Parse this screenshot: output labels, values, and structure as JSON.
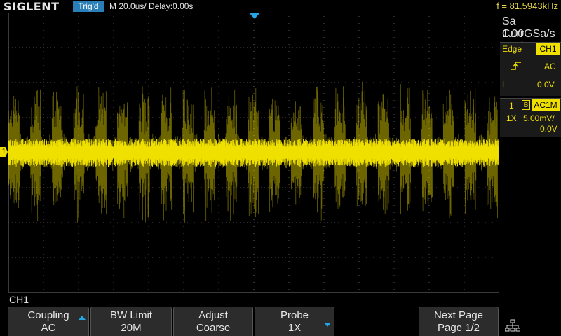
{
  "header": {
    "brand": "SIGLENT",
    "trigger_status": "Trig'd",
    "timebase": "M 20.0us/",
    "delay": "Delay:0.00s",
    "frequency": "f = 81.5943kHz"
  },
  "acquisition": {
    "sample_rate": "Sa 1.00GSa/s",
    "memory": "Curr 280kpts"
  },
  "trigger": {
    "type": "Edge",
    "source": "CH1",
    "slope_icon": "rising-edge-icon",
    "coupling": "AC",
    "level_label": "L",
    "level_value": "0.0V"
  },
  "channel1": {
    "number": "1",
    "bw_badge": "B",
    "coupling_impedance": "AC1M",
    "probe": "1X",
    "scale": "5.00mV/",
    "offset": "0.0V",
    "marker": "1",
    "menu_title": "CH1"
  },
  "softkeys": [
    {
      "title": "Coupling",
      "value": "AC"
    },
    {
      "title": "BW Limit",
      "value": "20M"
    },
    {
      "title": "Adjust",
      "value": "Coarse"
    },
    {
      "title": "Probe",
      "value": "1X"
    },
    {
      "title": "Next Page",
      "value": "Page 1/2"
    }
  ],
  "colors": {
    "channel1": "#f0e000",
    "accent": "#22a6e6",
    "trigger_badge": "#2a7fb8"
  }
}
